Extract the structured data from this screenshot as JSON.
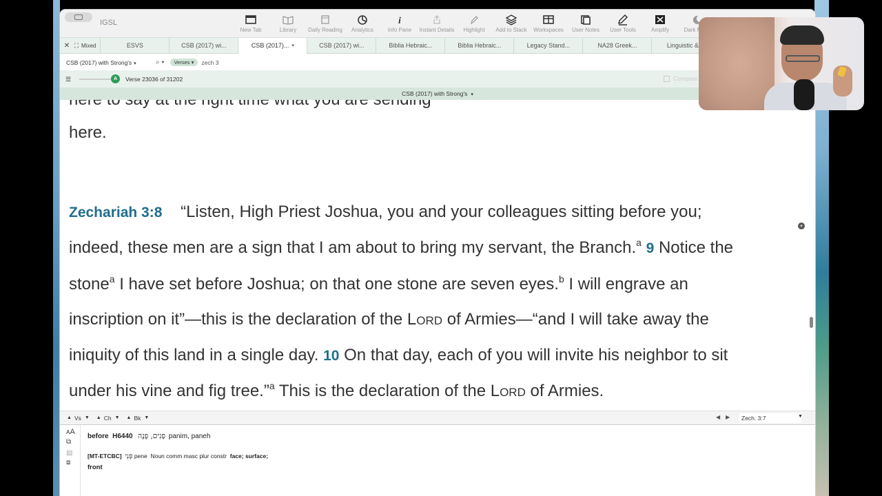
{
  "app": {
    "title": "IGSL"
  },
  "toolbar": [
    {
      "label": "New Tab",
      "icon": "new-tab-icon"
    },
    {
      "label": "Library",
      "icon": "library-icon"
    },
    {
      "label": "Daily Reading",
      "icon": "calendar-icon"
    },
    {
      "label": "Analytics",
      "icon": "analytics-icon"
    },
    {
      "label": "Info Pane",
      "icon": "info-icon"
    },
    {
      "label": "Instant Details",
      "icon": "share-icon"
    },
    {
      "label": "Highlight",
      "icon": "pencil-icon"
    },
    {
      "label": "Add to Stack",
      "icon": "stack-icon"
    },
    {
      "label": "Workspaces",
      "icon": "workspaces-icon"
    },
    {
      "label": "User Notes",
      "icon": "notes-icon"
    },
    {
      "label": "User Tools",
      "icon": "user-tools-icon"
    },
    {
      "label": "Amplify",
      "icon": "amplify-icon"
    },
    {
      "label": "Dark Mode",
      "icon": "dark-mode-icon"
    }
  ],
  "tabstrip": {
    "mixed_label": "Mixed",
    "tabs": [
      {
        "label": "ESVS"
      },
      {
        "label": "CSB (2017) wi..."
      },
      {
        "label": "CSB (2017)..."
      },
      {
        "label": "CSB (2017) wi..."
      },
      {
        "label": "Biblia Hebraic..."
      },
      {
        "label": "Biblia Hebraic..."
      },
      {
        "label": "Legacy Stand..."
      },
      {
        "label": "NA28 Greek..."
      },
      {
        "label": "Linguistic & ..."
      }
    ]
  },
  "search": {
    "resource": "CSB (2017) with Strong's",
    "mode_chip": "Verses",
    "query": "zech 3"
  },
  "nav": {
    "verse_count": "Verse 23036 of 31202",
    "knob_letter": "A",
    "compare_label": "Compare"
  },
  "resource_bar": {
    "label": "CSB (2017) with Strong's"
  },
  "text": {
    "partial_top": "here to say at the right time what you are sending",
    "here": "here.",
    "line1_ref": "Zechariah 3:8",
    "line1": "“Listen, High Priest Joshua, you and your colleagues sitting before you;",
    "line2": "indeed, these men are a sign that I am about to bring my servant, the Branch.",
    "line2_sup": "a",
    "line2_vnum": "9",
    "line2_end": "Notice the",
    "line3a": "stone",
    "line3_sup1": "a",
    "line3b": "I have set before Joshua; on that one stone are seven eyes.",
    "line3_sup2": "b",
    "line3c": "I will engrave an",
    "line4a": "inscription on it”—this is the declaration of the",
    "lord": "Lord",
    "line4b": "of Armies—“and I will take away the",
    "line5a": "iniquity of this land in a single day.",
    "line5_vnum": "10",
    "line5b": "On that day, each of you will invite his neighbor to sit",
    "line6a": "under his vine and fig tree.”",
    "line6_sup": "a",
    "line6b": "This is the declaration of the",
    "line6c": "of Armies."
  },
  "bottom_nav": {
    "vs": "Vs",
    "ch": "Ch",
    "bk": "Bk",
    "reference": "Zech. 3:7"
  },
  "info": {
    "word": "before",
    "strongs": "H6440",
    "hebrew": "פָּנִים, פָּנֶה",
    "translit": "panim, paneh",
    "source": "[MT-ETCBC]",
    "hebrew2": "פְּנֵי",
    "lemma": "pene",
    "morph": "Noun comm masc plur constr",
    "gloss": "face; surface;",
    "gloss2": "front"
  },
  "colors": {
    "accent": "#1f6e8c",
    "tab_bg": "#e9f1ec",
    "resource_bar": "#d6e6dc",
    "knob": "#2c9c5a"
  }
}
